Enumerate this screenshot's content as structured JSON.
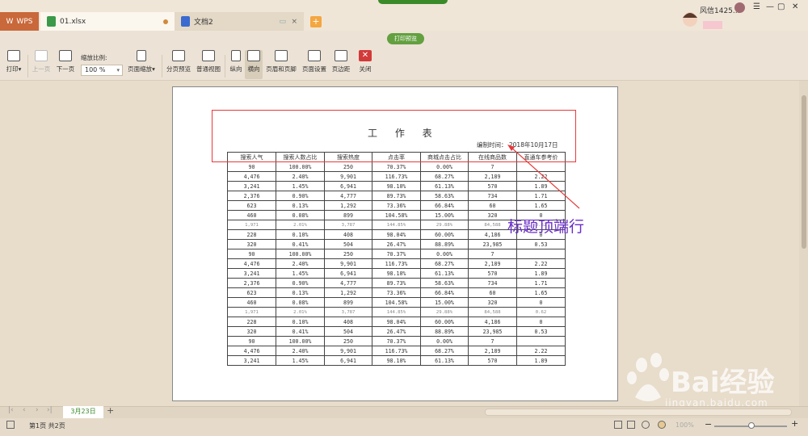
{
  "titlebar": {
    "app_tab": "WPS",
    "tabs": [
      {
        "label": "01.xlsx"
      },
      {
        "label": "文档2"
      }
    ],
    "user": "风信1425..."
  },
  "preview_mode": "打印预览",
  "toolbar": {
    "print": "打印",
    "prev_page": "上一页",
    "next_page": "下一页",
    "zoom_label": "缩放比例:",
    "zoom_value": "100 %",
    "page_zoom": "页面缩放",
    "page_break_preview": "分页预览",
    "normal_view": "普通视图",
    "portrait": "纵向",
    "landscape": "横向",
    "header_footer": "页眉和页脚",
    "page_setup": "页面设置",
    "margins": "页边距",
    "close": "关闭"
  },
  "sheet": {
    "title": "工 作 表",
    "date": "编制时间： 2018年10月17日",
    "headers": [
      "搜索人气",
      "搜索人数占比",
      "搜索热度",
      "点击率",
      "商城点击占比",
      "在线商品数",
      "直通车参考价"
    ],
    "rows": [
      [
        "90",
        "100.00%",
        "250",
        "70.37%",
        "0.00%",
        "7",
        ""
      ],
      [
        "4,476",
        "2.40%",
        "9,901",
        "116.73%",
        "68.27%",
        "2,189",
        "2.22"
      ],
      [
        "3,241",
        "1.45%",
        "6,941",
        "98.10%",
        "61.13%",
        "570",
        "1.89"
      ],
      [
        "2,376",
        "0.90%",
        "4,777",
        "89.73%",
        "58.63%",
        "734",
        "1.71"
      ],
      [
        "623",
        "0.13%",
        "1,292",
        "73.36%",
        "66.84%",
        "60",
        "1.65"
      ],
      [
        "460",
        "0.08%",
        "899",
        "104.58%",
        "15.00%",
        "320",
        "0"
      ],
      [
        "1,971",
        "2.01%",
        "3,787",
        "144.85%",
        "29.88%",
        "84,588",
        "0.62"
      ],
      [
        "228",
        "0.10%",
        "408",
        "98.04%",
        "60.00%",
        "4,186",
        "0"
      ],
      [
        "320",
        "0.41%",
        "504",
        "26.47%",
        "88.89%",
        "23,985",
        "0.53"
      ],
      [
        "90",
        "100.00%",
        "250",
        "70.37%",
        "0.00%",
        "7",
        ""
      ],
      [
        "4,476",
        "2.40%",
        "9,901",
        "116.73%",
        "68.27%",
        "2,189",
        "2.22"
      ],
      [
        "3,241",
        "1.45%",
        "6,941",
        "98.10%",
        "61.13%",
        "570",
        "1.89"
      ],
      [
        "2,376",
        "0.90%",
        "4,777",
        "89.73%",
        "58.63%",
        "734",
        "1.71"
      ],
      [
        "623",
        "0.13%",
        "1,292",
        "73.36%",
        "66.84%",
        "60",
        "1.65"
      ],
      [
        "460",
        "0.08%",
        "899",
        "104.58%",
        "15.00%",
        "320",
        "0"
      ],
      [
        "1,971",
        "2.01%",
        "3,787",
        "144.85%",
        "29.88%",
        "84,588",
        "0.62"
      ],
      [
        "228",
        "0.10%",
        "408",
        "98.04%",
        "60.00%",
        "4,186",
        "0"
      ],
      [
        "320",
        "0.41%",
        "504",
        "26.47%",
        "88.89%",
        "23,985",
        "0.53"
      ],
      [
        "90",
        "100.00%",
        "250",
        "70.37%",
        "0.00%",
        "7",
        ""
      ],
      [
        "4,476",
        "2.40%",
        "9,901",
        "116.73%",
        "68.27%",
        "2,189",
        "2.22"
      ],
      [
        "3,241",
        "1.45%",
        "6,941",
        "98.10%",
        "61.13%",
        "570",
        "1.89"
      ]
    ],
    "faint_rows": [
      6,
      15
    ]
  },
  "annotation": "标题顶端行",
  "sheet_tab": "3月23日",
  "status": {
    "page_info": "第1页 共2页",
    "zoom": "100%"
  },
  "watermark": {
    "text": "Bai经验",
    "url": "jingyan.baidu.com"
  },
  "colors": {
    "accent_green": "#63a040",
    "red_box": "#e53a3a",
    "annotation_purple": "#6a2ec7",
    "wps_tab": "#c9683a"
  }
}
